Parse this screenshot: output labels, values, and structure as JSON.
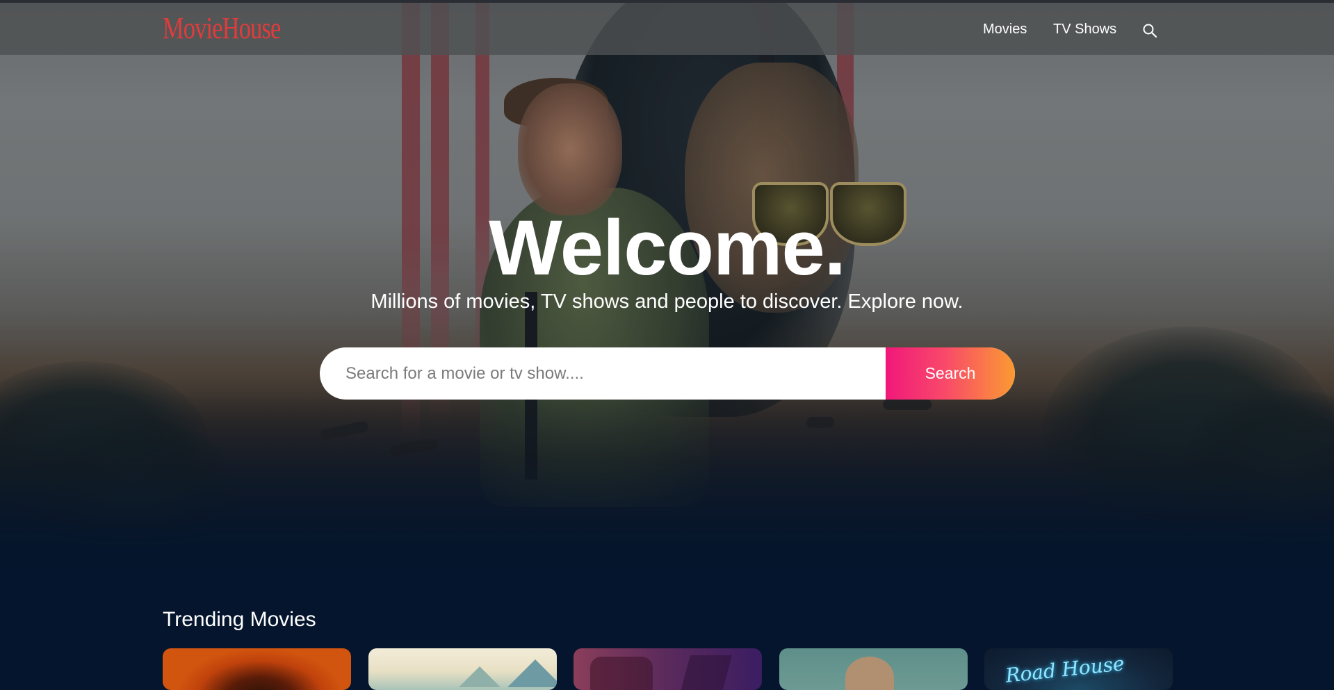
{
  "header": {
    "logo": "MovieHouse",
    "nav": {
      "movies": "Movies",
      "tv_shows": "TV Shows"
    },
    "search_icon": "search-icon"
  },
  "hero": {
    "title": "Welcome.",
    "subtitle": "Millions of movies, TV shows and people to discover. Explore now.",
    "search": {
      "placeholder": "Search for a movie or tv show....",
      "value": "",
      "button_label": "Search"
    }
  },
  "trending": {
    "title": "Trending Movies",
    "cards": [
      {
        "poster": "poster-1"
      },
      {
        "poster": "poster-2"
      },
      {
        "poster": "poster-3"
      },
      {
        "poster": "poster-4"
      },
      {
        "poster": "poster-5",
        "poster_text": "Road House"
      }
    ]
  },
  "colors": {
    "page_background": "#04152d",
    "logo": "#e23b3b",
    "search_button_gradient": [
      "#f0187a",
      "#fa9a32"
    ]
  }
}
